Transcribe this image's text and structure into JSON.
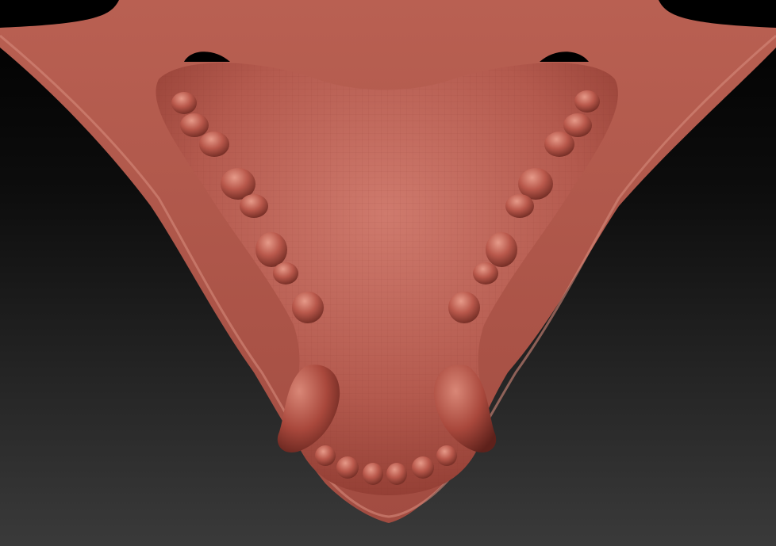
{
  "scene": {
    "subject": "sculpted-upper-jaw-model",
    "colors": {
      "background_top": "#000000",
      "background_bottom": "#3a3a3a",
      "clay_base": "#b0564b",
      "clay_light": "#d07a6c",
      "clay_dark": "#6e2a22",
      "tooth_highlight": "#e0907f"
    },
    "molars_per_side": 6,
    "incisor_count": 6,
    "canine_count": 2
  }
}
